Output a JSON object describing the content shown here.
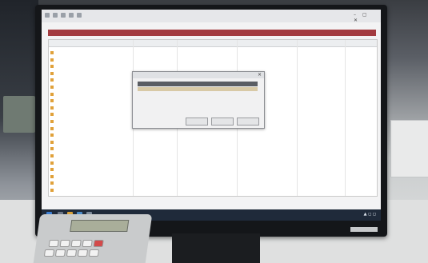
{
  "screen": {
    "window_header": "",
    "table_headers": [
      "",
      "",
      "",
      "",
      ""
    ],
    "rows": [
      {
        "name": "",
        "date": ""
      },
      {
        "name": "",
        "date": ""
      },
      {
        "name": "",
        "date": ""
      },
      {
        "name": "",
        "date": ""
      },
      {
        "name": "",
        "date": ""
      },
      {
        "name": "",
        "date": ""
      },
      {
        "name": "",
        "date": ""
      },
      {
        "name": "",
        "date": ""
      },
      {
        "name": "",
        "date": ""
      },
      {
        "name": "",
        "date": ""
      },
      {
        "name": "",
        "date": ""
      },
      {
        "name": "",
        "date": ""
      },
      {
        "name": "",
        "date": ""
      },
      {
        "name": "",
        "date": ""
      },
      {
        "name": "",
        "date": ""
      },
      {
        "name": "",
        "date": ""
      },
      {
        "name": "",
        "date": ""
      },
      {
        "name": "",
        "date": ""
      },
      {
        "name": "",
        "date": ""
      },
      {
        "name": "",
        "date": ""
      },
      {
        "name": "",
        "date": ""
      }
    ],
    "dialog": {
      "lines": [
        "",
        "",
        "",
        ""
      ],
      "buttons": [
        "",
        "",
        ""
      ]
    }
  },
  "colors": {
    "header_red": "#a33b40",
    "taskbar": "#1f2a3a",
    "folder_icon": "#e0a13a"
  },
  "icons": [
    "folder-icon",
    "close-icon",
    "window-controls-icon"
  ]
}
